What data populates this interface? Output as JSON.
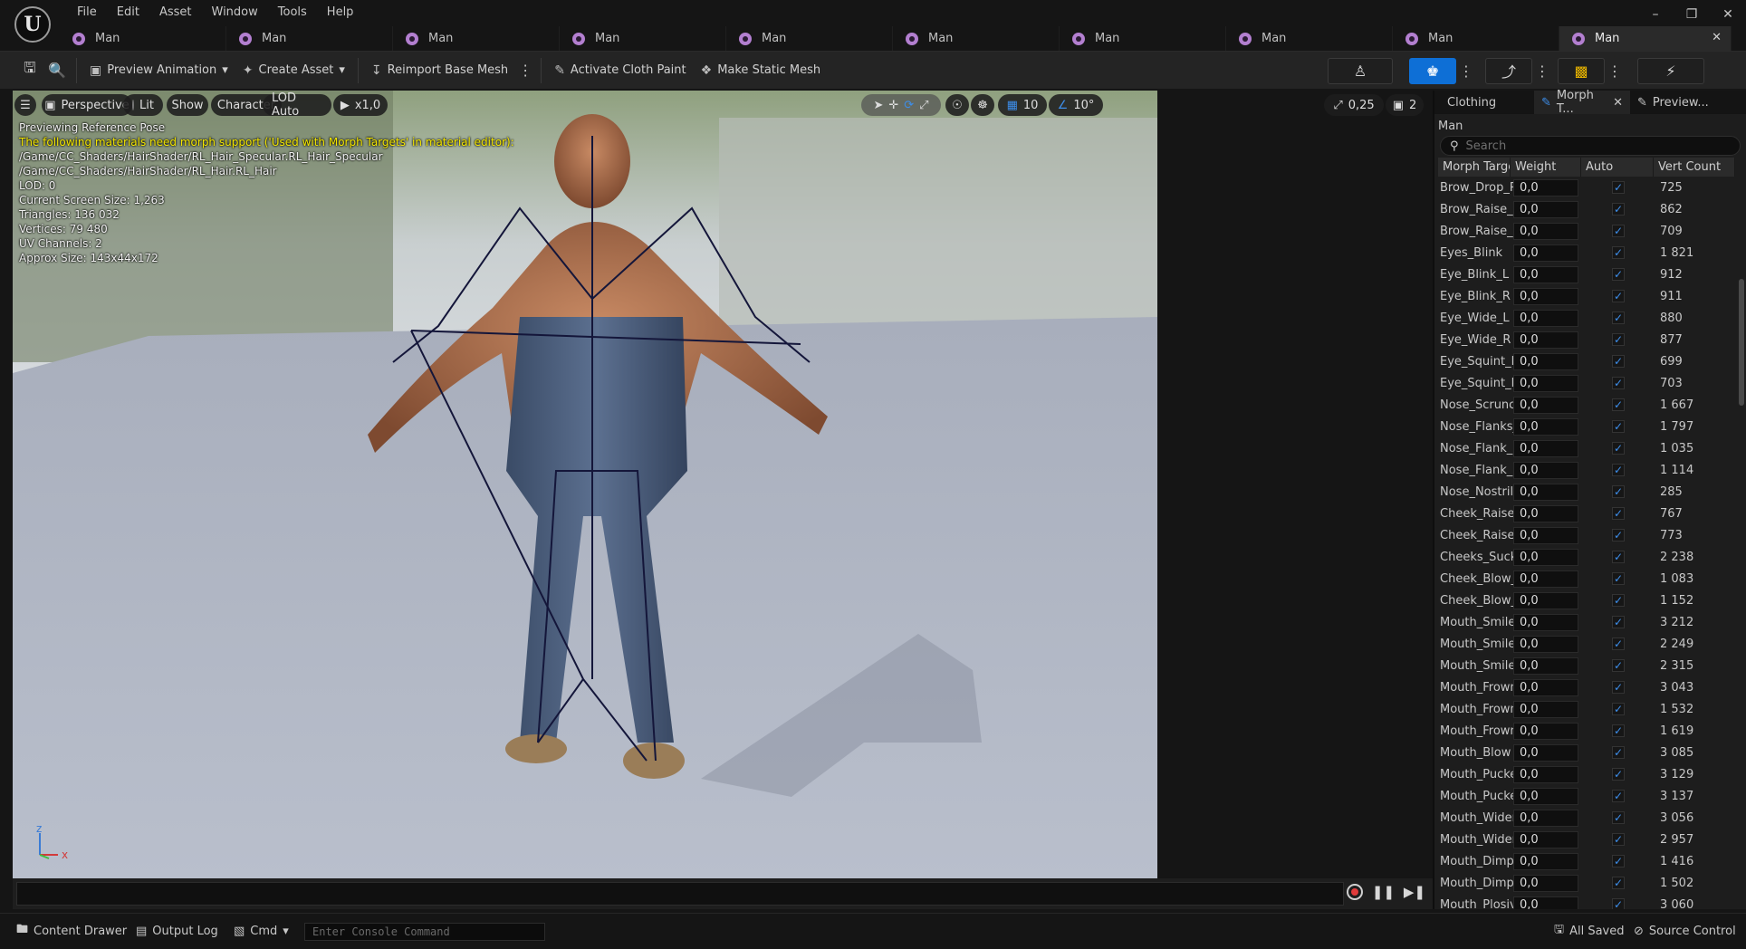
{
  "menu": {
    "items": [
      "File",
      "Edit",
      "Asset",
      "Window",
      "Tools",
      "Help"
    ]
  },
  "tabs": [
    {
      "label": "Man"
    },
    {
      "label": "Man"
    },
    {
      "label": "Man"
    },
    {
      "label": "Man"
    },
    {
      "label": "Man"
    },
    {
      "label": "Man"
    },
    {
      "label": "Man"
    },
    {
      "label": "Man"
    },
    {
      "label": "Man"
    },
    {
      "label": "Man"
    }
  ],
  "toolbar": {
    "preview_animation": "Preview Animation",
    "create_asset": "Create Asset",
    "reimport_base_mesh": "Reimport Base Mesh",
    "activate_cloth_paint": "Activate Cloth Paint",
    "make_static_mesh": "Make Static Mesh"
  },
  "viewport": {
    "perspective": "Perspective",
    "lit": "Lit",
    "show": "Show",
    "character": "Character",
    "lod": "LOD Auto",
    "play_rate": "x1,0",
    "grid_size": "10",
    "rotation_snap": "10°",
    "scale_snap": "0,25",
    "camera_speed": "2",
    "info": {
      "mode": "Previewing Reference Pose",
      "warning": "The following materials need morph support ('Used with Morph Targets' in material editor):",
      "material1": "/Game/CC_Shaders/HairShader/RL_Hair_Specular.RL_Hair_Specular",
      "material2": "/Game/CC_Shaders/HairShader/RL_Hair.RL_Hair",
      "lod": "LOD: 0",
      "screen_size": "Current Screen Size: 1,263",
      "triangles": "Triangles: 136 032",
      "vertices": "Vertices: 79 480",
      "uv_channels": "UV Channels: 2",
      "approx_size": "Approx Size: 143x44x172"
    },
    "axis_x": "x",
    "axis_z": "z"
  },
  "panel": {
    "tabs": [
      "Clothing",
      "Morph T...",
      "Preview..."
    ],
    "title": "Man",
    "search_placeholder": "Search",
    "columns": [
      "Morph Targe",
      "Weight",
      "Auto",
      "Vert Count"
    ],
    "rows": [
      {
        "name": "Brow_Drop_R",
        "weight": "0,0",
        "count": "725"
      },
      {
        "name": "Brow_Raise_L",
        "weight": "0,0",
        "count": "862"
      },
      {
        "name": "Brow_Raise_F",
        "weight": "0,0",
        "count": "709"
      },
      {
        "name": "Eyes_Blink",
        "weight": "0,0",
        "count": "1 821"
      },
      {
        "name": "Eye_Blink_L",
        "weight": "0,0",
        "count": "912"
      },
      {
        "name": "Eye_Blink_R",
        "weight": "0,0",
        "count": "911"
      },
      {
        "name": "Eye_Wide_L",
        "weight": "0,0",
        "count": "880"
      },
      {
        "name": "Eye_Wide_R",
        "weight": "0,0",
        "count": "877"
      },
      {
        "name": "Eye_Squint_L",
        "weight": "0,0",
        "count": "699"
      },
      {
        "name": "Eye_Squint_R",
        "weight": "0,0",
        "count": "703"
      },
      {
        "name": "Nose_Scruncl",
        "weight": "0,0",
        "count": "1 667"
      },
      {
        "name": "Nose_Flanks_",
        "weight": "0,0",
        "count": "1 797"
      },
      {
        "name": "Nose_Flank_R",
        "weight": "0,0",
        "count": "1 035"
      },
      {
        "name": "Nose_Flank_R",
        "weight": "0,0",
        "count": "1 114"
      },
      {
        "name": "Nose_Nostrils",
        "weight": "0,0",
        "count": "285"
      },
      {
        "name": "Cheek_Raise_",
        "weight": "0,0",
        "count": "767"
      },
      {
        "name": "Cheek_Raise_",
        "weight": "0,0",
        "count": "773"
      },
      {
        "name": "Cheeks_Suck",
        "weight": "0,0",
        "count": "2 238"
      },
      {
        "name": "Cheek_Blow_L",
        "weight": "0,0",
        "count": "1 083"
      },
      {
        "name": "Cheek_Blow_F",
        "weight": "0,0",
        "count": "1 152"
      },
      {
        "name": "Mouth_Smile",
        "weight": "0,0",
        "count": "3 212"
      },
      {
        "name": "Mouth_Smile_",
        "weight": "0,0",
        "count": "2 249"
      },
      {
        "name": "Mouth_Smile_",
        "weight": "0,0",
        "count": "2 315"
      },
      {
        "name": "Mouth_Frown",
        "weight": "0,0",
        "count": "3 043"
      },
      {
        "name": "Mouth_Frown_",
        "weight": "0,0",
        "count": "1 532"
      },
      {
        "name": "Mouth_Frown_",
        "weight": "0,0",
        "count": "1 619"
      },
      {
        "name": "Mouth_Blow",
        "weight": "0,0",
        "count": "3 085"
      },
      {
        "name": "Mouth_Pucker",
        "weight": "0,0",
        "count": "3 129"
      },
      {
        "name": "Mouth_Pucker",
        "weight": "0,0",
        "count": "3 137"
      },
      {
        "name": "Mouth_Widen",
        "weight": "0,0",
        "count": "3 056"
      },
      {
        "name": "Mouth_Widen_",
        "weight": "0,0",
        "count": "2 957"
      },
      {
        "name": "Mouth_Dimple",
        "weight": "0,0",
        "count": "1 416"
      },
      {
        "name": "Mouth_Dimple",
        "weight": "0,0",
        "count": "1 502"
      },
      {
        "name": "Mouth_Plosive",
        "weight": "0,0",
        "count": "3 060"
      }
    ]
  },
  "statusbar": {
    "content_drawer": "Content Drawer",
    "output_log": "Output Log",
    "cmd": "Cmd",
    "console_placeholder": "Enter Console Command",
    "all_saved": "All Saved",
    "source_control": "Source Control"
  },
  "colors": {
    "accent": "#0e6fd6",
    "warning": "#f3e600",
    "tab_icon": "#b37fd0"
  }
}
